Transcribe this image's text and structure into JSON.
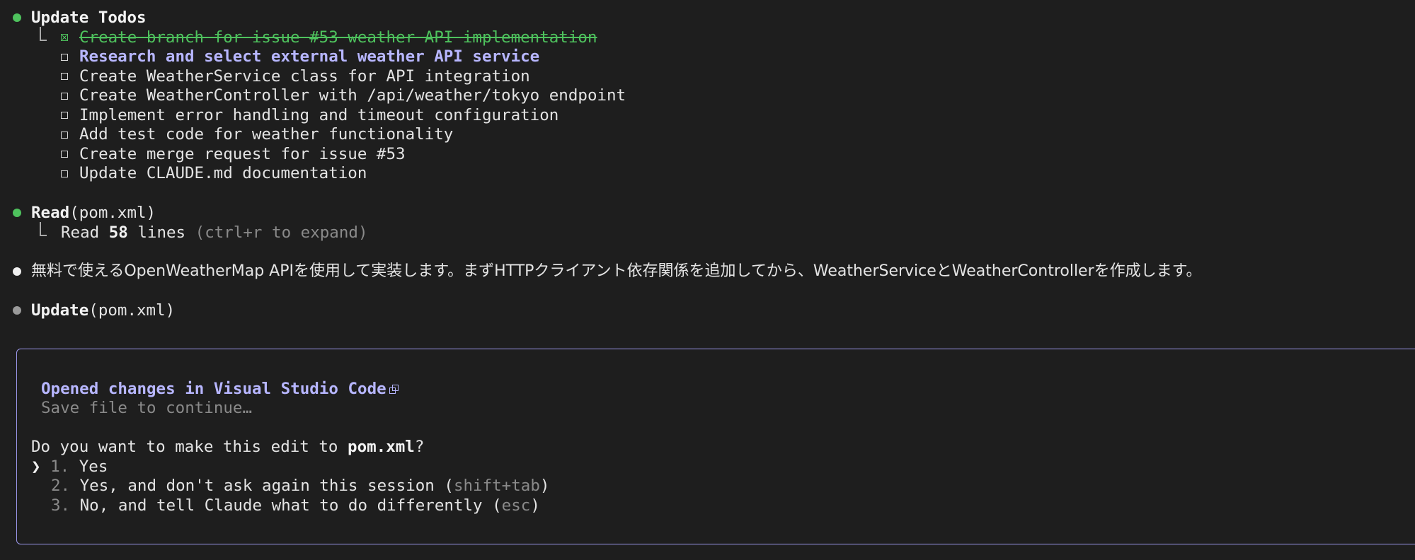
{
  "update_todos": {
    "title": "Update Todos",
    "items": [
      {
        "text": "Create branch for issue #53 weather API implementation",
        "state": "done"
      },
      {
        "text": "Research and select external weather API service",
        "state": "in_progress"
      },
      {
        "text": "Create WeatherService class for API integration",
        "state": "pending"
      },
      {
        "text": "Create WeatherController with /api/weather/tokyo endpoint",
        "state": "pending"
      },
      {
        "text": "Implement error handling and timeout configuration",
        "state": "pending"
      },
      {
        "text": "Add test code for weather functionality",
        "state": "pending"
      },
      {
        "text": "Create merge request for issue #53",
        "state": "pending"
      },
      {
        "text": "Update CLAUDE.md documentation",
        "state": "pending"
      }
    ]
  },
  "read_step": {
    "tool": "Read",
    "arg": "(pom.xml)",
    "result_prefix": "Read ",
    "line_count": "58",
    "result_suffix": " lines ",
    "hint": "(ctrl+r to expand)"
  },
  "message": {
    "text": "無料で使えるOpenWeatherMap APIを使用して実装します。まずHTTPクライアント依存関係を追加してから、WeatherServiceとWeatherControllerを作成します。"
  },
  "update_step": {
    "tool": "Update",
    "arg": "(pom.xml)"
  },
  "prompt_panel": {
    "opened_text": "Opened changes in Visual Studio Code",
    "save_hint": "Save file to continue…",
    "question_prefix": "Do you want to make this edit to ",
    "question_file": "pom.xml",
    "question_suffix": "?",
    "cursor": "❯",
    "options": [
      {
        "num": "1.",
        "label": "Yes",
        "key": "",
        "key_suffix": ""
      },
      {
        "num": "2.",
        "label": "Yes, and don't ask again this session (",
        "key": "shift+tab",
        "key_suffix": ")"
      },
      {
        "num": "3.",
        "label": "No, and tell Claude what to do differently (",
        "key": "esc",
        "key_suffix": ")"
      }
    ]
  },
  "colors": {
    "background": "#1e1e1e",
    "done_green": "#4ec25d",
    "accent_purple": "#b7b6ff",
    "panel_border": "#9a96e8",
    "dim_gray": "#8a8a8a"
  }
}
